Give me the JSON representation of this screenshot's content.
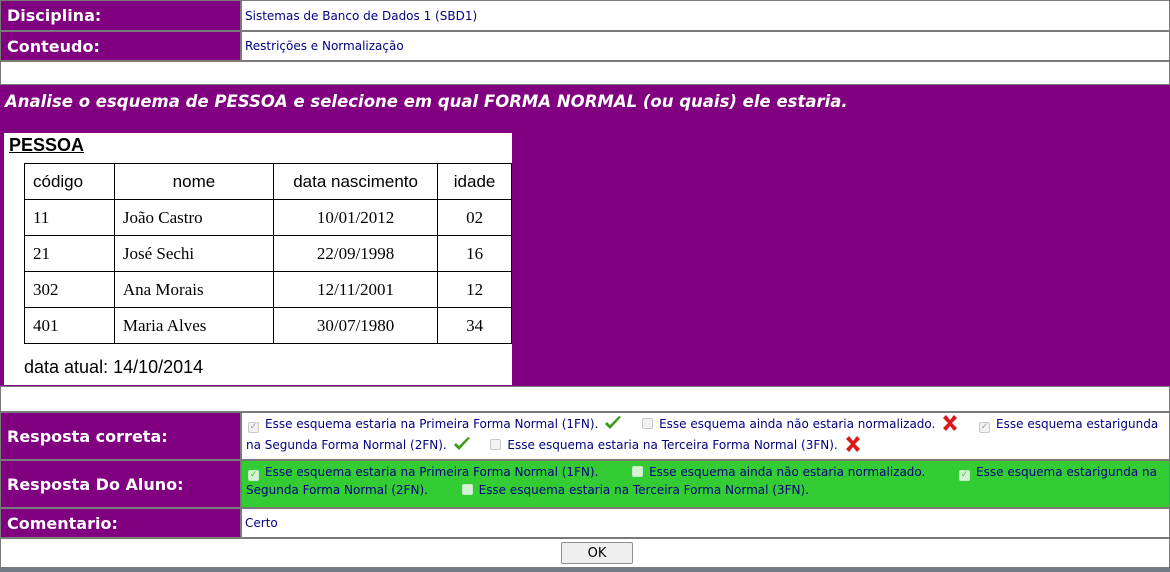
{
  "disciplina": {
    "label": "Disciplina:",
    "value": "Sistemas de Banco de Dados 1 (SBD1)"
  },
  "conteudo": {
    "label": "Conteudo:",
    "value": "Restrições e Normalização"
  },
  "question": {
    "text": "Analise o esquema de PESSOA e selecione em qual FORMA NORMAL (ou quais) ele estaria.",
    "image": {
      "title": "PESSOA",
      "headers": [
        "código",
        "nome",
        "data nascimento",
        "idade"
      ],
      "rows": [
        [
          "11",
          "João Castro",
          "10/01/2012",
          "02"
        ],
        [
          "21",
          "José Sechi",
          "22/09/1998",
          "16"
        ],
        [
          "302",
          "Ana Morais",
          "12/11/2001",
          "12"
        ],
        [
          "401",
          "Maria Alves",
          "30/07/1980",
          "34"
        ]
      ],
      "current_date": "data atual: 14/10/2014"
    }
  },
  "resposta_correta": {
    "label": "Resposta correta:",
    "options": [
      {
        "text": "Esse esquema estaria na Primeira Forma Normal (1FN).",
        "checked": true,
        "mark": "check-icon"
      },
      {
        "text": "Esse esquema ainda não estaria normalizado.",
        "checked": false,
        "mark": "cross-icon"
      },
      {
        "text": "Esse esquema estarigunda na Segunda Forma Normal (2FN).",
        "checked": true,
        "mark": "check-icon"
      },
      {
        "text": "Esse esquema estaria na Terceira Forma Normal (3FN).",
        "checked": false,
        "mark": "cross-icon"
      }
    ]
  },
  "resposta_aluno": {
    "label": "Resposta Do Aluno:",
    "options": [
      {
        "text": "Esse esquema estaria na Primeira Forma Normal (1FN).",
        "checked": true
      },
      {
        "text": "Esse esquema ainda não estaria normalizado.",
        "checked": false
      },
      {
        "text": "Esse esquema estarigunda na Segunda Forma Normal (2FN).",
        "checked": true
      },
      {
        "text": "Esse esquema estaria na Terceira Forma Normal (3FN).",
        "checked": false
      }
    ]
  },
  "comentario": {
    "label": "Comentario:",
    "value": "Certo"
  },
  "ok_button": "OK",
  "colors": {
    "label_bg": "#800080",
    "student_bg": "#33cc33",
    "value_text": "#000080",
    "check": "#3a9a1a",
    "cross": "#d91a1a"
  }
}
